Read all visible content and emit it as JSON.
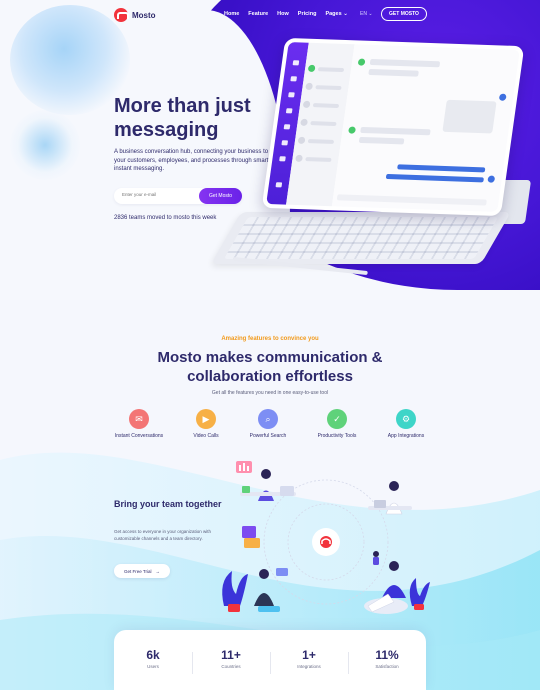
{
  "brand": {
    "name": "Mosto",
    "accent": "#f2333c",
    "primary": "#2e2a6b",
    "purple": "#5b1ee6"
  },
  "nav": {
    "links": [
      "Home",
      "Feature",
      "How",
      "Pricing",
      "Pages"
    ],
    "language": "EN",
    "cta": "GET MOSTO"
  },
  "hero": {
    "title": "More than just messaging",
    "description": "A business conversation hub, connecting your business to your customers, employees, and processes through smart instant messaging.",
    "email_placeholder": "Enter your e-mail",
    "email_button": "Get Mosto",
    "teams_note": "2836 teams moved to mosto this week"
  },
  "features": {
    "eyebrow": "Amazing features to convince you",
    "title": "Mosto makes communication & collaboration effortless",
    "subtitle": "Get all the features you need in one easy-to-use tool",
    "items": [
      {
        "label": "Instant Conversations",
        "icon": "chat-icon",
        "color": "#f37575"
      },
      {
        "label": "Video Calls",
        "icon": "video-icon",
        "color": "#f7b046"
      },
      {
        "label": "Powerful Search",
        "icon": "search-icon",
        "color": "#7d8ef4"
      },
      {
        "label": "Productivity Tools",
        "icon": "tools-icon",
        "color": "#5fd27a"
      },
      {
        "label": "App Integrations",
        "icon": "integration-icon",
        "color": "#3ed5c8"
      }
    ]
  },
  "team": {
    "title": "Bring your team together",
    "description": "Get access to everyone in your organization with customizable channels and a team directory.",
    "button": "Get Free Trial",
    "button_arrow": "→"
  },
  "stats": [
    {
      "value": "6k",
      "label": "Users"
    },
    {
      "value": "11+",
      "label": "Countries"
    },
    {
      "value": "1+",
      "label": "Integrations"
    },
    {
      "value": "11%",
      "label": "Satisfaction"
    }
  ]
}
